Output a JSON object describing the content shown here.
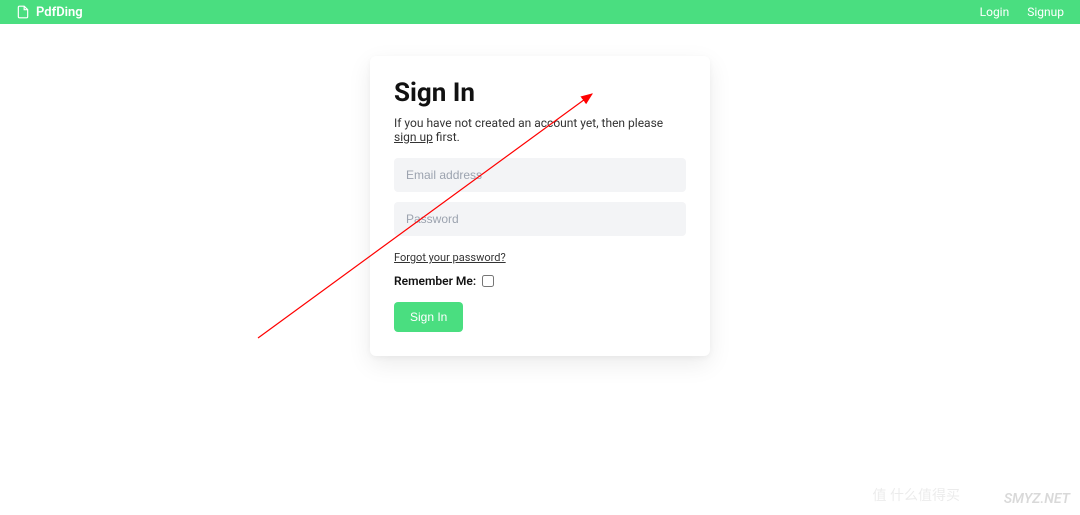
{
  "header": {
    "brand": "PdfDing",
    "login": "Login",
    "signup": "Signup"
  },
  "card": {
    "title": "Sign In",
    "subtitle_prefix": "If you have not created an account yet, then please ",
    "subtitle_link": "sign up",
    "subtitle_suffix": " first.",
    "email_placeholder": "Email address",
    "password_placeholder": "Password",
    "forgot": "Forgot your password?",
    "remember": "Remember Me:",
    "submit": "Sign In"
  },
  "watermark": {
    "left": "值 什么值得买",
    "right": "SMYZ.NET"
  }
}
